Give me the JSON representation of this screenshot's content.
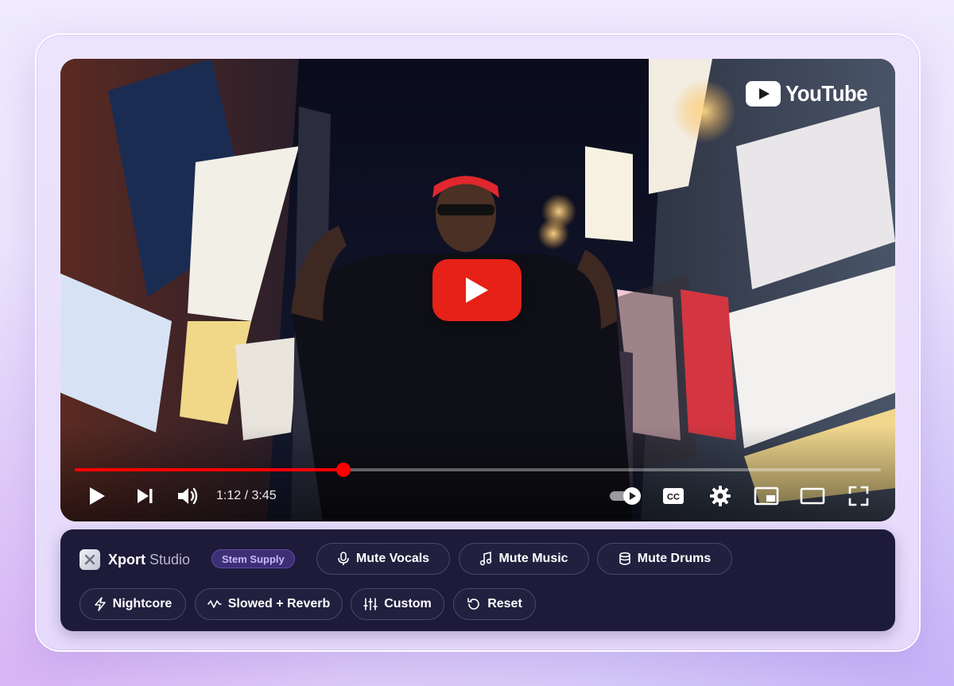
{
  "player": {
    "logo_text": "YouTube",
    "time_display": "1:12 / 3:45",
    "progress_fraction": 0.333,
    "colors": {
      "accent": "#ff0000",
      "play_button": "#e62117"
    },
    "icons": [
      "play-icon",
      "next-icon",
      "volume-icon",
      "autoplay-toggle",
      "captions-icon",
      "settings-icon",
      "miniplayer-icon",
      "theater-icon",
      "fullscreen-icon"
    ],
    "cc_label": "CC"
  },
  "toolbar": {
    "brand_name": "Xport",
    "brand_suffix": "Studio",
    "badge": "Stem Supply",
    "row1": [
      {
        "label": "Mute Vocals",
        "icon": "microphone-icon"
      },
      {
        "label": "Mute Music",
        "icon": "music-note-icon"
      },
      {
        "label": "Mute Drums",
        "icon": "drum-icon"
      }
    ],
    "row2": [
      {
        "label": "Nightcore",
        "icon": "lightning-icon"
      },
      {
        "label": "Slowed + Reverb",
        "icon": "wave-icon"
      },
      {
        "label": "Custom",
        "icon": "sliders-icon"
      },
      {
        "label": "Reset",
        "icon": "reset-icon"
      }
    ],
    "colors": {
      "background": "#1e1b3a",
      "badge_bg": "#3d2f73",
      "badge_text": "#c9b6ff"
    }
  }
}
